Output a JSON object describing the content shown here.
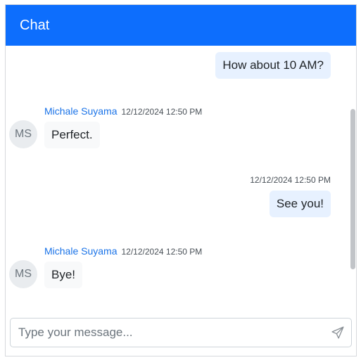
{
  "header": {
    "title": "Chat"
  },
  "messages": [
    {
      "type": "sent",
      "text": "How about 10 AM?"
    },
    {
      "type": "received",
      "author": "Michale Suyama",
      "initials": "MS",
      "time": "12/12/2024 12:50 PM",
      "text": "Perfect."
    },
    {
      "type": "sent",
      "time": "12/12/2024 12:50 PM",
      "text": "See you!"
    },
    {
      "type": "received",
      "author": "Michale Suyama",
      "initials": "MS",
      "time": "12/12/2024 12:50 PM",
      "text": "Bye!"
    }
  ],
  "composer": {
    "placeholder": "Type your message...",
    "send_icon": "send-icon"
  },
  "colors": {
    "header": "#0d6efd",
    "author": "#1a73e8",
    "sent_bubble": "#e7f1ff",
    "received_bubble": "#f8f9fa"
  }
}
